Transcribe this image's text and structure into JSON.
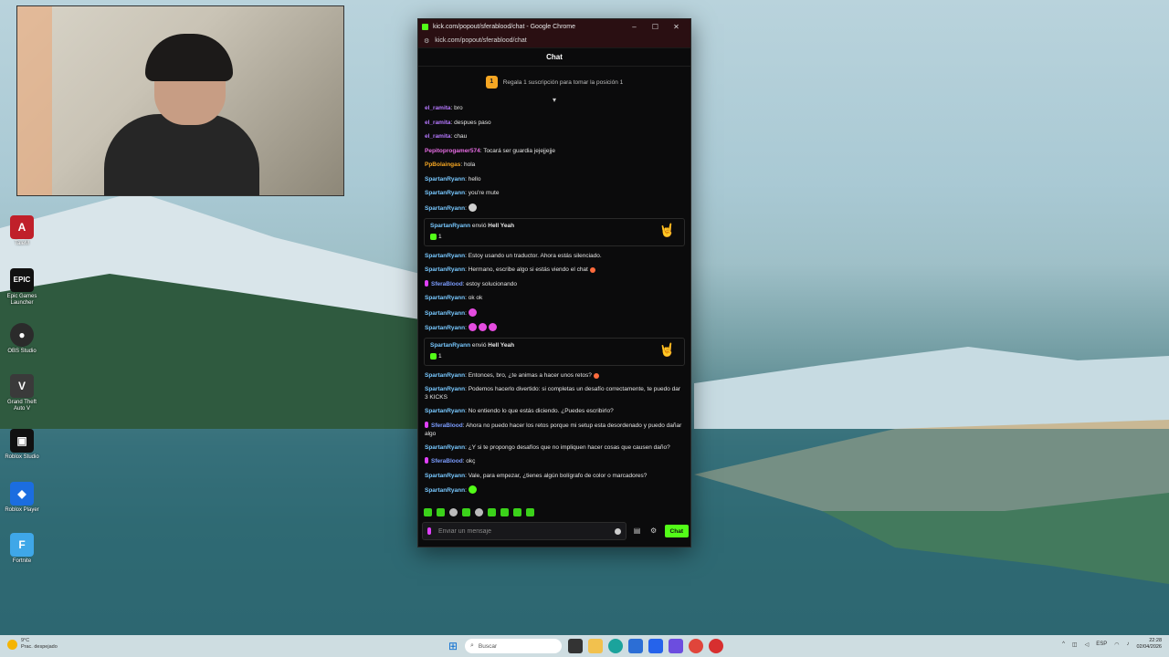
{
  "window": {
    "title": "kick.com/popout/sferablood/chat - Google Chrome",
    "url": "kick.com/popout/sferablood/chat",
    "minimize": "–",
    "maximize": "☐",
    "close": "✕"
  },
  "chat": {
    "header": "Chat",
    "pinned_rank": "1",
    "pinned_text": "Regala 1 suscripción para tomar la posición 1",
    "input_placeholder": "Enviar un mensaje",
    "send_label": "Chat"
  },
  "colors": {
    "kick_green": "#53fc18",
    "user_purple": "#b678ff",
    "user_pink": "#e86de4",
    "user_orange": "#f5a623",
    "user_blue": "#78c8ff",
    "user_sfera": "#7c9dff"
  },
  "messages": [
    {
      "user": "el_ramita",
      "text": "bro",
      "color": "#b678ff"
    },
    {
      "user": "el_ramita",
      "text": "despues paso",
      "color": "#b678ff"
    },
    {
      "user": "el_ramita",
      "text": "chau",
      "color": "#b678ff"
    },
    {
      "user": "Pepitoprogamer574",
      "text": "Tocará ser guardia jejejjejje",
      "color": "#e86de4"
    },
    {
      "user": "PpBolaingas",
      "text": "hola",
      "color": "#f5a623"
    },
    {
      "user": "SpartanRyann",
      "text": "hello",
      "color": "#78c8ff"
    },
    {
      "user": "SpartanRyann",
      "text": "you're mute",
      "color": "#78c8ff"
    },
    {
      "user": "SpartanRyann",
      "text": "",
      "color": "#78c8ff",
      "emotes": [
        "gray"
      ]
    },
    {
      "gift": true,
      "user": "SpartanRyann",
      "verb": "envió",
      "item": "Hell Yeah",
      "count": "1",
      "icon": "rock-hand-icon"
    },
    {
      "user": "SpartanRyann",
      "text": "Estoy usando un traductor. Ahora estás silenciado.",
      "color": "#78c8ff"
    },
    {
      "user": "SpartanRyann",
      "text": "Hermano, escribe algo si estás viendo el chat",
      "color": "#78c8ff",
      "trail": [
        "red"
      ]
    },
    {
      "user": "SferaBlood",
      "text": "estoy solucionando",
      "color": "#7c9dff",
      "mic": true
    },
    {
      "user": "SpartanRyann",
      "text": "ok ok",
      "color": "#78c8ff"
    },
    {
      "user": "SpartanRyann",
      "text": "",
      "color": "#78c8ff",
      "emotes": [
        "pink"
      ]
    },
    {
      "user": "SpartanRyann",
      "text": "",
      "color": "#78c8ff",
      "emotes": [
        "pink",
        "pink",
        "pink"
      ]
    },
    {
      "gift": true,
      "user": "SpartanRyann",
      "verb": "envió",
      "item": "Hell Yeah",
      "count": "1",
      "icon": "rock-hand-icon"
    },
    {
      "user": "SpartanRyann",
      "text": "Entonces, bro, ¿te animas a hacer unos retos?",
      "color": "#78c8ff",
      "trail": [
        "red"
      ]
    },
    {
      "user": "SpartanRyann",
      "text": "Podemos hacerlo divertido: si completas un desafío correctamente, te puedo dar 3 KICKS",
      "color": "#78c8ff"
    },
    {
      "user": "SpartanRyann",
      "text": "No entiendo lo que estás diciendo. ¿Puedes escribirlo?",
      "color": "#78c8ff"
    },
    {
      "user": "SferaBlood",
      "text": "Ahora no puedo hacer los retos porque mi setup esta desordenado y puedo dañar algo",
      "color": "#7c9dff",
      "mic": true
    },
    {
      "user": "SpartanRyann",
      "text": "¿Y si te propongo desafíos que no impliquen hacer cosas que causen daño?",
      "color": "#78c8ff"
    },
    {
      "user": "SferaBlood",
      "text": "okç",
      "color": "#7c9dff",
      "mic": true
    },
    {
      "user": "SpartanRyann",
      "text": "Vale, para empezar, ¿tienes algún bolígrafo de color o marcadores?",
      "color": "#78c8ff"
    },
    {
      "user": "SpartanRyann",
      "text": "",
      "color": "#78c8ff",
      "emotes": [
        "green"
      ]
    }
  ],
  "desktop_icons": [
    {
      "label": "TaleM",
      "color": "#c0202a",
      "glyph": "A"
    },
    {
      "label": "Epic Games Launcher",
      "color": "#111111",
      "glyph": "EPIC"
    },
    {
      "label": "OBS Studio",
      "color": "#2b2b2b",
      "glyph": "●"
    },
    {
      "label": "Grand Theft Auto V",
      "color": "#3a3a3a",
      "glyph": "V"
    },
    {
      "label": "Roblox Studio",
      "color": "#111111",
      "glyph": "▣"
    },
    {
      "label": "Roblox Player",
      "color": "#1b6de0",
      "glyph": "◆"
    },
    {
      "label": "Fortnite",
      "color": "#3fa7e8",
      "glyph": "F"
    }
  ],
  "taskbar": {
    "weather_temp": "9°C",
    "weather_desc": "Prac. despejado",
    "search_placeholder": "Buscar",
    "lang": "ESP",
    "time": "22:28",
    "date": "02/04/2026"
  }
}
